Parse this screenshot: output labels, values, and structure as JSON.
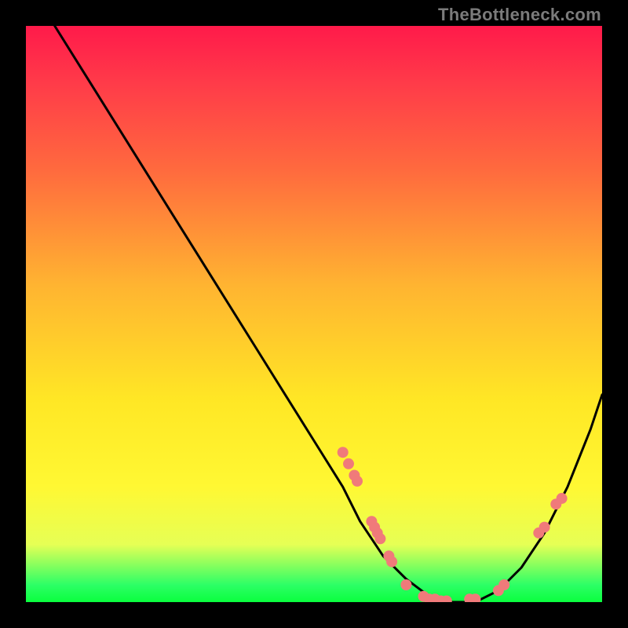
{
  "watermark": "TheBottleneck.com",
  "chart_data": {
    "type": "line",
    "title": "",
    "xlabel": "",
    "ylabel": "",
    "xlim": [
      0,
      100
    ],
    "ylim": [
      0,
      100
    ],
    "grid": false,
    "legend": false,
    "series": [
      {
        "name": "bottleneck-curve",
        "color": "#000000",
        "x": [
          5,
          10,
          15,
          20,
          25,
          30,
          35,
          40,
          45,
          50,
          55,
          58,
          62,
          66,
          70,
          74,
          78,
          82,
          86,
          90,
          94,
          98,
          100
        ],
        "y": [
          100,
          92,
          84,
          76,
          68,
          60,
          52,
          44,
          36,
          28,
          20,
          14,
          8,
          4,
          1,
          0,
          0,
          2,
          6,
          12,
          20,
          30,
          36
        ]
      }
    ],
    "markers": [
      {
        "name": "dot",
        "color": "#f07a7a",
        "x": 55,
        "y": 26
      },
      {
        "name": "dot",
        "color": "#f07a7a",
        "x": 56,
        "y": 24
      },
      {
        "name": "dot",
        "color": "#f07a7a",
        "x": 57,
        "y": 22
      },
      {
        "name": "dot",
        "color": "#f07a7a",
        "x": 57.5,
        "y": 21
      },
      {
        "name": "dot",
        "color": "#f07a7a",
        "x": 60,
        "y": 14
      },
      {
        "name": "dot",
        "color": "#f07a7a",
        "x": 60.5,
        "y": 13
      },
      {
        "name": "dot",
        "color": "#f07a7a",
        "x": 61,
        "y": 12
      },
      {
        "name": "dot",
        "color": "#f07a7a",
        "x": 61.5,
        "y": 11
      },
      {
        "name": "dot",
        "color": "#f07a7a",
        "x": 63,
        "y": 8
      },
      {
        "name": "dot",
        "color": "#f07a7a",
        "x": 63.5,
        "y": 7
      },
      {
        "name": "dot",
        "color": "#f07a7a",
        "x": 66,
        "y": 3
      },
      {
        "name": "dot",
        "color": "#f07a7a",
        "x": 69,
        "y": 1
      },
      {
        "name": "dot",
        "color": "#f07a7a",
        "x": 70,
        "y": 0.5
      },
      {
        "name": "dot",
        "color": "#f07a7a",
        "x": 71,
        "y": 0.5
      },
      {
        "name": "dot",
        "color": "#f07a7a",
        "x": 72,
        "y": 0.2
      },
      {
        "name": "dot",
        "color": "#f07a7a",
        "x": 73,
        "y": 0.2
      },
      {
        "name": "dot",
        "color": "#f07a7a",
        "x": 77,
        "y": 0.5
      },
      {
        "name": "dot",
        "color": "#f07a7a",
        "x": 78,
        "y": 0.5
      },
      {
        "name": "dot",
        "color": "#f07a7a",
        "x": 82,
        "y": 2
      },
      {
        "name": "dot",
        "color": "#f07a7a",
        "x": 83,
        "y": 3
      },
      {
        "name": "dot",
        "color": "#f07a7a",
        "x": 89,
        "y": 12
      },
      {
        "name": "dot",
        "color": "#f07a7a",
        "x": 90,
        "y": 13
      },
      {
        "name": "dot",
        "color": "#f07a7a",
        "x": 92,
        "y": 17
      },
      {
        "name": "dot",
        "color": "#f07a7a",
        "x": 93,
        "y": 18
      }
    ],
    "background_gradient": {
      "top": "#ff1a4a",
      "mid": "#ffe725",
      "bottom": "#0aff3e"
    }
  }
}
